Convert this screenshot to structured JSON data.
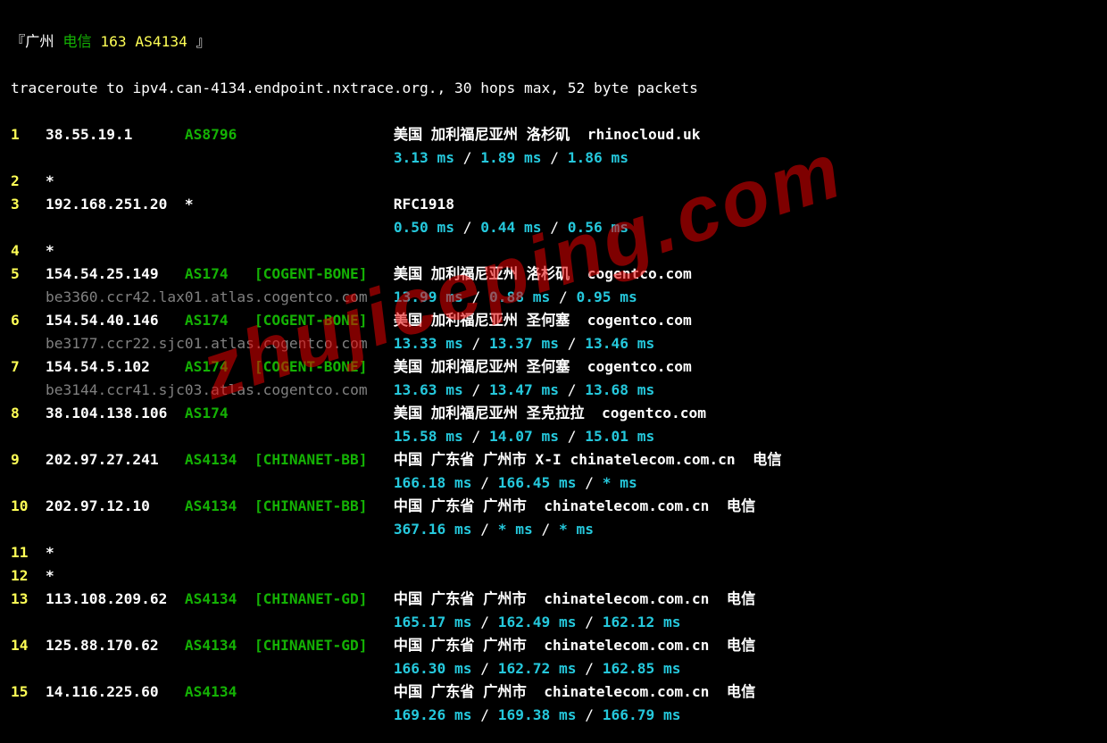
{
  "header": {
    "open": "『",
    "city": "广州 ",
    "carrier": "电信",
    "backbone": " 163",
    "asn": " AS4134",
    "close": " 』"
  },
  "cmd": "traceroute to ipv4.can-4134.endpoint.nxtrace.org., 30 hops max, 52 byte packets",
  "watermark": "zhujiceping.com",
  "hops": [
    {
      "num": "1",
      "ip": "38.55.19.1",
      "as": "AS8796",
      "tag": "",
      "loc": "美国 加利福尼亚州 洛杉矶  rhinocloud.uk",
      "timing": "3.13 ms / 1.89 ms / 1.86 ms"
    },
    {
      "num": "2",
      "ip": "*",
      "as": "",
      "tag": "",
      "loc": "",
      "timing": ""
    },
    {
      "num": "3",
      "ip": "192.168.251.20",
      "as": "*",
      "tag": "",
      "loc": "RFC1918",
      "timing": "0.50 ms / 0.44 ms / 0.56 ms"
    },
    {
      "num": "4",
      "ip": "*",
      "as": "",
      "tag": "",
      "loc": "",
      "timing": ""
    },
    {
      "num": "5",
      "ip": "154.54.25.149",
      "as": "AS174",
      "tag": "[COGENT-BONE]",
      "loc": "美国 加利福尼亚州 洛杉矶  cogentco.com",
      "timing": "13.99 ms / 0.88 ms / 0.95 ms",
      "ptr": "be3360.ccr42.lax01.atlas.cogentco.com"
    },
    {
      "num": "6",
      "ip": "154.54.40.146",
      "as": "AS174",
      "tag": "[COGENT-BONE]",
      "loc": "美国 加利福尼亚州 圣何塞  cogentco.com",
      "timing": "13.33 ms / 13.37 ms / 13.46 ms",
      "ptr": "be3177.ccr22.sjc01.atlas.cogentco.com"
    },
    {
      "num": "7",
      "ip": "154.54.5.102",
      "as": "AS174",
      "tag": "[COGENT-BONE]",
      "loc": "美国 加利福尼亚州 圣何塞  cogentco.com",
      "timing": "13.63 ms / 13.47 ms / 13.68 ms",
      "ptr": "be3144.ccr41.sjc03.atlas.cogentco.com"
    },
    {
      "num": "8",
      "ip": "38.104.138.106",
      "as": "AS174",
      "tag": "",
      "loc": "美国 加利福尼亚州 圣克拉拉  cogentco.com",
      "timing": "15.58 ms / 14.07 ms / 15.01 ms"
    },
    {
      "num": "9",
      "ip": "202.97.27.241",
      "as": "AS4134",
      "tag": "[CHINANET-BB]",
      "loc": "中国 广东省 广州市 X-I chinatelecom.com.cn  电信",
      "timing": "166.18 ms / 166.45 ms / * ms"
    },
    {
      "num": "10",
      "ip": "202.97.12.10",
      "as": "AS4134",
      "tag": "[CHINANET-BB]",
      "loc": "中国 广东省 广州市  chinatelecom.com.cn  电信",
      "timing": "367.16 ms / * ms / * ms"
    },
    {
      "num": "11",
      "ip": "*",
      "as": "",
      "tag": "",
      "loc": "",
      "timing": ""
    },
    {
      "num": "12",
      "ip": "*",
      "as": "",
      "tag": "",
      "loc": "",
      "timing": ""
    },
    {
      "num": "13",
      "ip": "113.108.209.62",
      "as": "AS4134",
      "tag": "[CHINANET-GD]",
      "loc": "中国 广东省 广州市  chinatelecom.com.cn  电信",
      "timing": "165.17 ms / 162.49 ms / 162.12 ms"
    },
    {
      "num": "14",
      "ip": "125.88.170.62",
      "as": "AS4134",
      "tag": "[CHINANET-GD]",
      "loc": "中国 广东省 广州市  chinatelecom.com.cn  电信",
      "timing": "166.30 ms / 162.72 ms / 162.85 ms"
    },
    {
      "num": "15",
      "ip": "14.116.225.60",
      "as": "AS4134",
      "tag": "",
      "loc": "中国 广东省 广州市  chinatelecom.com.cn  电信",
      "timing": "169.26 ms / 169.38 ms / 166.79 ms"
    }
  ]
}
